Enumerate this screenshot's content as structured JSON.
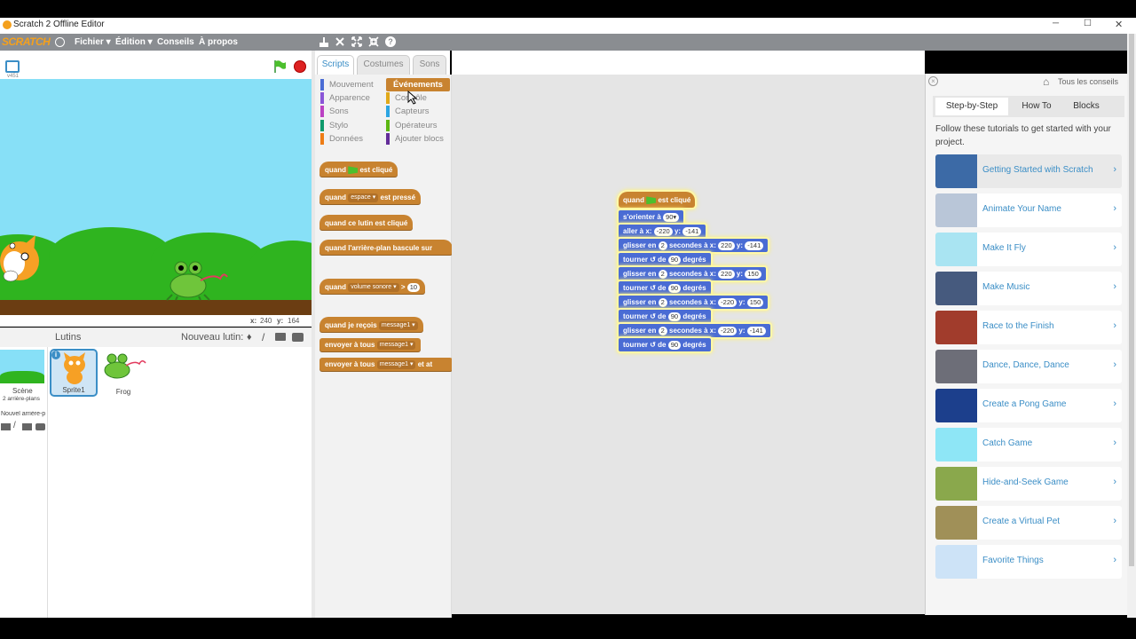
{
  "window": {
    "title": "Scratch 2 Offline Editor",
    "min": "─",
    "max": "☐",
    "close": "✕"
  },
  "menu": {
    "logo": "SCRATCH",
    "file": "Fichier ▾",
    "edit": "Édition ▾",
    "tips": "Conseils",
    "about": "À propos"
  },
  "stage": {
    "version": "v451",
    "coords_x_label": "x:",
    "coords_x": "240",
    "coords_y_label": "y:",
    "coords_y": "164"
  },
  "sprites": {
    "title": "Lutins",
    "new_sprite": "Nouveau lutin:",
    "scene_label": "Scène",
    "scene_sub": "2 arrière-plans",
    "new_backdrop": "Nouvel arrière-p",
    "items": [
      {
        "name": "Sprite1"
      },
      {
        "name": "Frog"
      }
    ]
  },
  "tabs": {
    "scripts": "Scripts",
    "costumes": "Costumes",
    "sounds": "Sons"
  },
  "categories": [
    {
      "label": "Mouvement",
      "color": "#4a6cd4"
    },
    {
      "label": "Apparence",
      "color": "#8a55d7"
    },
    {
      "label": "Sons",
      "color": "#bb42c3"
    },
    {
      "label": "Stylo",
      "color": "#0e9a6c"
    },
    {
      "label": "Données",
      "color": "#ee7d16"
    },
    {
      "label": "Événements",
      "color": "#c88330"
    },
    {
      "label": "Contrôle",
      "color": "#e1a91a"
    },
    {
      "label": "Capteurs",
      "color": "#2ca5e2"
    },
    {
      "label": "Opérateurs",
      "color": "#5cb712"
    },
    {
      "label": "Ajouter blocs",
      "color": "#632d99"
    }
  ],
  "palette": {
    "b1a": "quand",
    "b1b": "est cliqué",
    "b2a": "quand",
    "b2dd": "espace ▾",
    "b2b": "est pressé",
    "b3": "quand ce lutin est cliqué",
    "b4": "quand l'arrière-plan bascule sur",
    "b5a": "quand",
    "b5dd": "volume sonore ▾",
    "b5op": ">",
    "b5val": "10",
    "b6a": "quand je reçois",
    "b6dd": "message1 ▾",
    "b7a": "envoyer à tous",
    "b7dd": "message1 ▾",
    "b8a": "envoyer à tous",
    "b8dd": "message1 ▾",
    "b8b": "et at"
  },
  "script": {
    "hat_a": "quand",
    "hat_b": "est cliqué",
    "orient": "s'orienter à",
    "orient_val": "90▾",
    "goto": "aller à x:",
    "goto_x": "-220",
    "goto_y_lbl": "y:",
    "goto_y": "-141",
    "glide": "glisser en",
    "secs": "2",
    "secs_lbl": "secondes à x:",
    "y_lbl": "y:",
    "g1x": "220",
    "g1y": "-141",
    "g2x": "220",
    "g2y": "150",
    "g3x": "-220",
    "g3y": "150",
    "g4x": "-220",
    "g4y": "-141",
    "turn": "tourner",
    "de": "de",
    "deg": "90",
    "degrees": "degrés"
  },
  "tips": {
    "all_tips": "Tous les conseils",
    "tabs": [
      "Step-by-Step",
      "How To",
      "Blocks"
    ],
    "intro": "Follow these tutorials to get started with your project.",
    "items": [
      {
        "label": "Getting Started with Scratch",
        "color": "#3c6aa6"
      },
      {
        "label": "Animate Your Name",
        "color": "#b9c6d8"
      },
      {
        "label": "Make It Fly",
        "color": "#a9e4f2"
      },
      {
        "label": "Make Music",
        "color": "#465a7e"
      },
      {
        "label": "Race to the Finish",
        "color": "#a13c2c"
      },
      {
        "label": "Dance, Dance, Dance",
        "color": "#6d6e78"
      },
      {
        "label": "Create a Pong Game",
        "color": "#1c3f8c"
      },
      {
        "label": "Catch Game",
        "color": "#8ee6f6"
      },
      {
        "label": "Hide-and-Seek Game",
        "color": "#8aa84c"
      },
      {
        "label": "Create a Virtual Pet",
        "color": "#a09058"
      },
      {
        "label": "Favorite Things",
        "color": "#cde3f7"
      }
    ]
  }
}
